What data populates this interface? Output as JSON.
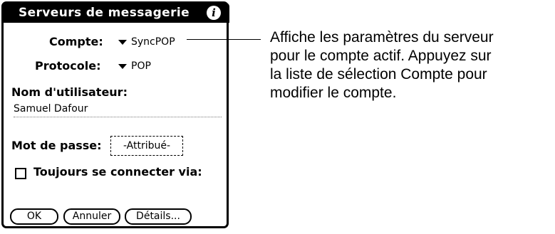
{
  "dialog": {
    "title": "Serveurs de messagerie",
    "info_icon": "info-icon",
    "account": {
      "label": "Compte:",
      "value": "SyncPOP"
    },
    "protocol": {
      "label": "Protocole:",
      "value": "POP"
    },
    "username": {
      "label": "Nom d'utilisateur:",
      "value": "Samuel Dafour"
    },
    "password": {
      "label": "Mot de passe:",
      "value": "-Attribué-"
    },
    "always_connect": {
      "label": "Toujours se connecter via:",
      "checked": false
    },
    "buttons": {
      "ok": "OK",
      "cancel": "Annuler",
      "details": "Détails..."
    }
  },
  "callout": {
    "lines": [
      "Affiche les paramètres du serveur",
      "pour le compte actif. Appuyez sur",
      "la liste de sélection Compte pour",
      "modifier le compte."
    ]
  }
}
